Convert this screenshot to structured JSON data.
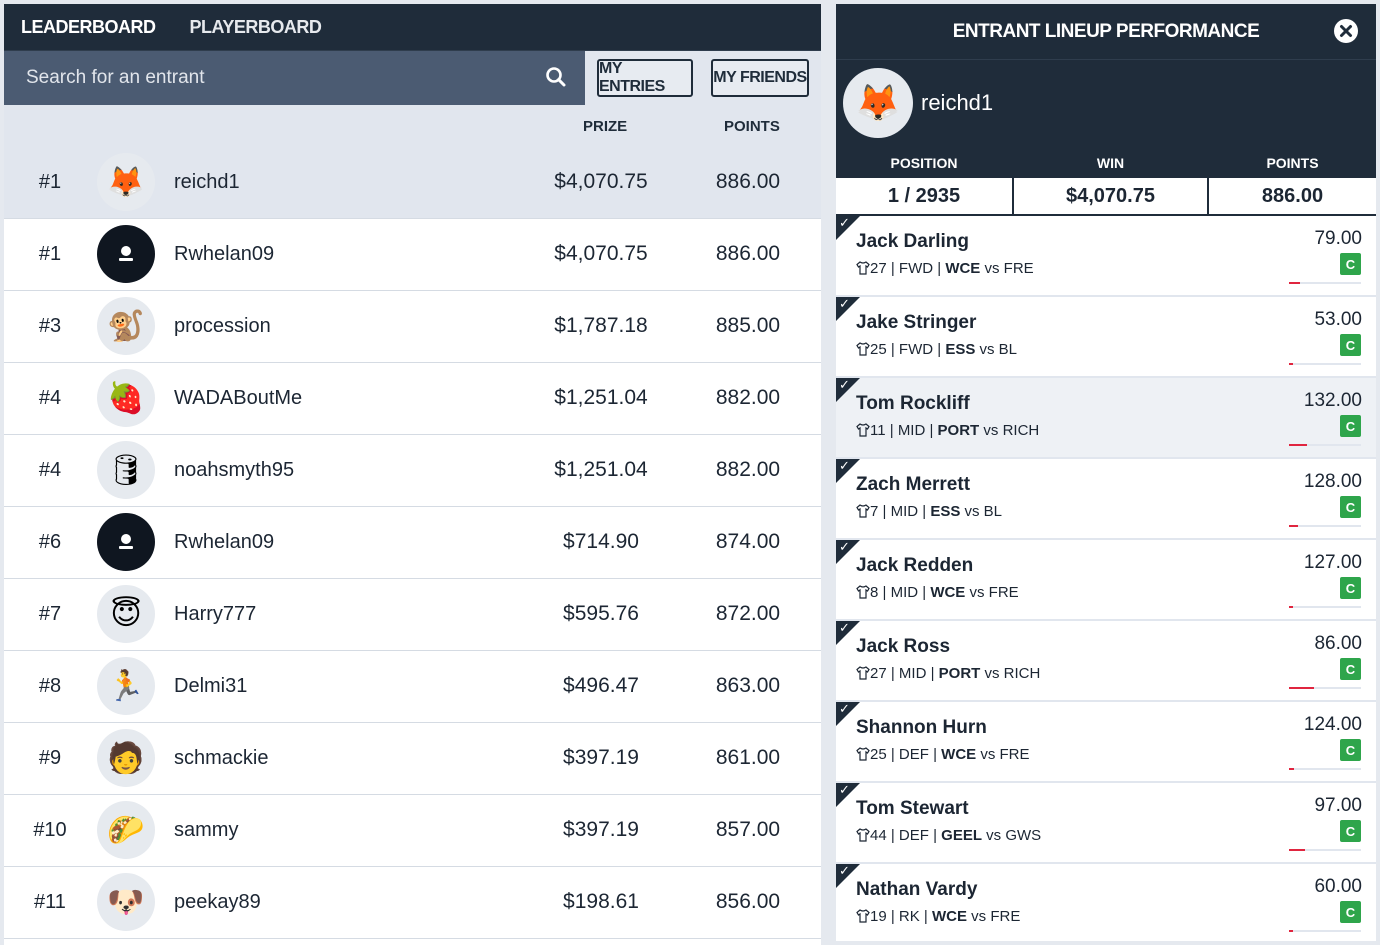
{
  "tabs": {
    "leaderboard": "LEADERBOARD",
    "playerboard": "PLAYERBOARD"
  },
  "search": {
    "placeholder": "Search for an entrant"
  },
  "filters": {
    "my_entries": "MY ENTRIES",
    "my_friends": "MY FRIENDS"
  },
  "columns": {
    "prize": "PRIZE",
    "points": "POINTS"
  },
  "leaderboard": [
    {
      "rank": "#1",
      "name": "reichd1",
      "prize": "$4,070.75",
      "points": "886.00",
      "avatar": "fox-avatar",
      "emoji": "🦊",
      "highlight": true
    },
    {
      "rank": "#1",
      "name": "Rwhelan09",
      "prize": "$4,070.75",
      "points": "886.00",
      "avatar": "default-user-avatar",
      "emoji": "",
      "dark": true
    },
    {
      "rank": "#3",
      "name": "procession",
      "prize": "$1,787.18",
      "points": "885.00",
      "avatar": "photo-avatar",
      "emoji": "🐒"
    },
    {
      "rank": "#4",
      "name": "WADABoutMe",
      "prize": "$1,251.04",
      "points": "882.00",
      "avatar": "strawberry-avatar",
      "emoji": "🍓"
    },
    {
      "rank": "#4",
      "name": "noahsmyth95",
      "prize": "$1,251.04",
      "points": "882.00",
      "avatar": "barrel-avatar",
      "emoji": "🛢"
    },
    {
      "rank": "#6",
      "name": "Rwhelan09",
      "prize": "$714.90",
      "points": "874.00",
      "avatar": "default-user-avatar",
      "emoji": "",
      "dark": true
    },
    {
      "rank": "#7",
      "name": "Harry777",
      "prize": "$595.76",
      "points": "872.00",
      "avatar": "angel-avatar",
      "emoji": "😇"
    },
    {
      "rank": "#8",
      "name": "Delmi31",
      "prize": "$496.47",
      "points": "863.00",
      "avatar": "photo-avatar",
      "emoji": "🏃"
    },
    {
      "rank": "#9",
      "name": "schmackie",
      "prize": "$397.19",
      "points": "861.00",
      "avatar": "photo-avatar",
      "emoji": "🧑"
    },
    {
      "rank": "#10",
      "name": "sammy",
      "prize": "$397.19",
      "points": "857.00",
      "avatar": "taco-avatar",
      "emoji": "🌮"
    },
    {
      "rank": "#11",
      "name": "peekay89",
      "prize": "$198.61",
      "points": "856.00",
      "avatar": "dog-avatar",
      "emoji": "🐶"
    }
  ],
  "panel": {
    "title": "ENTRANT LINEUP PERFORMANCE",
    "user": "reichd1",
    "user_emoji": "🦊",
    "stats": [
      {
        "label": "POSITION",
        "value": "1 / 2935"
      },
      {
        "label": "WIN",
        "value": "$4,070.75"
      },
      {
        "label": "POINTS",
        "value": "886.00"
      }
    ],
    "players": [
      {
        "name": "Jack Darling",
        "number": "27",
        "pos": "FWD",
        "team": "WCE",
        "vs": "vs",
        "opp": "FRE",
        "points": "79.00",
        "cap": "C",
        "progress": 0.15
      },
      {
        "name": "Jake Stringer",
        "number": "25",
        "pos": "FWD",
        "team": "ESS",
        "vs": "vs",
        "opp": "BL",
        "points": "53.00",
        "cap": "C",
        "progress": 0.05
      },
      {
        "name": "Tom Rockliff",
        "number": "11",
        "pos": "MID",
        "team": "PORT",
        "vs": "vs",
        "opp": "RICH",
        "points": "132.00",
        "cap": "C",
        "progress": 0.25,
        "highlight": true
      },
      {
        "name": "Zach Merrett",
        "number": "7",
        "pos": "MID",
        "team": "ESS",
        "vs": "vs",
        "opp": "BL",
        "points": "128.00",
        "cap": "C",
        "progress": 0.13
      },
      {
        "name": "Jack Redden",
        "number": "8",
        "pos": "MID",
        "team": "WCE",
        "vs": "vs",
        "opp": "FRE",
        "points": "127.00",
        "cap": "C",
        "progress": 0.05
      },
      {
        "name": "Jack Ross",
        "number": "27",
        "pos": "MID",
        "team": "PORT",
        "vs": "vs",
        "opp": "RICH",
        "points": "86.00",
        "cap": "C",
        "progress": 0.35
      },
      {
        "name": "Shannon Hurn",
        "number": "25",
        "pos": "DEF",
        "team": "WCE",
        "vs": "vs",
        "opp": "FRE",
        "points": "124.00",
        "cap": "C",
        "progress": 0.07
      },
      {
        "name": "Tom Stewart",
        "number": "44",
        "pos": "DEF",
        "team": "GEEL",
        "vs": "vs",
        "opp": "GWS",
        "points": "97.00",
        "cap": "C",
        "progress": 0.22
      },
      {
        "name": "Nathan Vardy",
        "number": "19",
        "pos": "RK",
        "team": "WCE",
        "vs": "vs",
        "opp": "FRE",
        "points": "60.00",
        "cap": "C",
        "progress": 0.05
      }
    ]
  },
  "colors": {
    "navy": "#1f2c3a",
    "searchbg": "#4b5b72",
    "captain": "#2ea54b",
    "progress": "#e0253f"
  }
}
